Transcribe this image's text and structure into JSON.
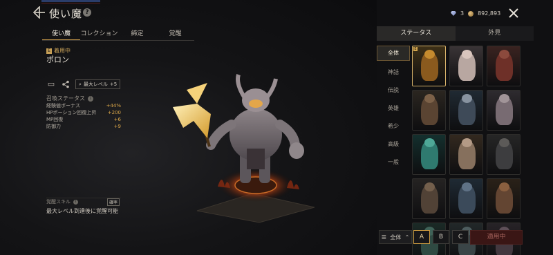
{
  "header": {
    "title": "使い魔",
    "back_icon": "back-arrow-icon",
    "help_icon_text": "?"
  },
  "tabs": [
    {
      "label": "使い魔",
      "active": true
    },
    {
      "label": "コレクション",
      "active": false
    },
    {
      "label": "締定",
      "active": false
    },
    {
      "label": "覚醒",
      "active": false
    }
  ],
  "familiar": {
    "status_badge": "着用中",
    "name": "ポロン",
    "level_pill": "最大レベル",
    "level_value": "+5"
  },
  "stats": {
    "title": "召喚ステータス",
    "rows": [
      {
        "label": "経験値ボーナス",
        "value": "+44%"
      },
      {
        "label": "HPポーション回復上昇",
        "value": "+200"
      },
      {
        "label": "MP回復",
        "value": "+6"
      },
      {
        "label": "防御力",
        "value": "+9"
      }
    ]
  },
  "awakening": {
    "title": "覚醒スキル",
    "tag": "確率",
    "note": "最大レベル到達後に覚醒可能"
  },
  "currency": {
    "gems": "3",
    "gold": "892,893"
  },
  "right_tabs": [
    {
      "label": "ステータス",
      "active": true
    },
    {
      "label": "外見",
      "active": false
    }
  ],
  "grades": [
    {
      "label": "全体",
      "active": true
    },
    {
      "label": "神話",
      "active": false
    },
    {
      "label": "伝説",
      "active": false
    },
    {
      "label": "英雄",
      "active": false
    },
    {
      "label": "希少",
      "active": false
    },
    {
      "label": "高級",
      "active": false
    },
    {
      "label": "一般",
      "active": false
    }
  ],
  "cards": [
    {
      "bg": "#3d3017",
      "fig": "#8a5a1e",
      "head": "#c48a2e",
      "selected": true,
      "equipped": true
    },
    {
      "bg": "#3a3436",
      "fig": "#b8a7a1",
      "head": "#d9c5bd",
      "selected": false,
      "equipped": false
    },
    {
      "bg": "#3a2320",
      "fig": "#6e3028",
      "head": "#8c4a3d",
      "selected": false,
      "equipped": false
    },
    {
      "bg": "#2b2620",
      "fig": "#5a4432",
      "head": "#7c6148",
      "selected": false,
      "equipped": false
    },
    {
      "bg": "#202a33",
      "fig": "#3e4a58",
      "head": "#8893a0",
      "selected": false,
      "equipped": false
    },
    {
      "bg": "#2e2b2f",
      "fig": "#786b72",
      "head": "#a19498",
      "selected": false,
      "equipped": false
    },
    {
      "bg": "#14302e",
      "fig": "#2f7a6f",
      "head": "#4ea897",
      "selected": false,
      "equipped": false
    },
    {
      "bg": "#33291f",
      "fig": "#86705d",
      "head": "#b39a86",
      "selected": false,
      "equipped": false
    },
    {
      "bg": "#262626",
      "fig": "#3d3d3f",
      "head": "#5c5a58",
      "selected": false,
      "equipped": false
    },
    {
      "bg": "#252322",
      "fig": "#514236",
      "head": "#735f4c",
      "selected": false,
      "equipped": false
    },
    {
      "bg": "#1f2a34",
      "fig": "#3b4a5a",
      "head": "#5f7286",
      "selected": false,
      "equipped": false
    },
    {
      "bg": "#2a2118",
      "fig": "#634532",
      "head": "#8a5f3f",
      "selected": false,
      "equipped": false
    },
    {
      "bg": "#1b2a26",
      "fig": "#2f4a42",
      "head": "#3f6258",
      "selected": false,
      "equipped": false
    },
    {
      "bg": "#222829",
      "fig": "#3a4547",
      "head": "#4d5c5e",
      "selected": false,
      "equipped": false
    },
    {
      "bg": "#272327",
      "fig": "#43383f",
      "head": "#5e4f58",
      "selected": false,
      "equipped": false
    }
  ],
  "bottom": {
    "filter_label": "全体",
    "presets": [
      {
        "label": "A",
        "active": true
      },
      {
        "label": "B",
        "active": false
      },
      {
        "label": "C",
        "active": false
      }
    ],
    "apply_label": "適用中"
  },
  "colors": {
    "accent_gold": "#c99a4a",
    "stat_value": "#d8a548",
    "apply_bg": "#3a1615"
  }
}
